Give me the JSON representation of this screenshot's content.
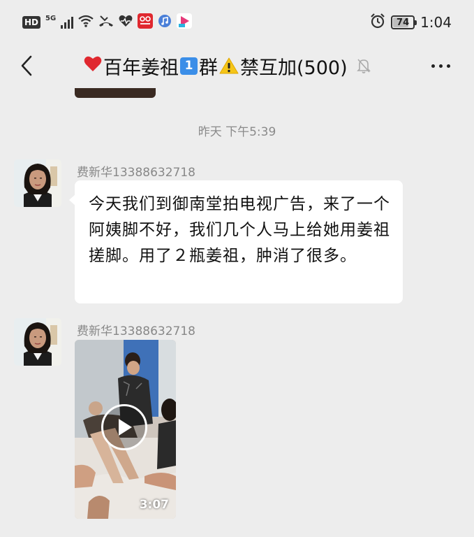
{
  "status_bar": {
    "hd_label": "HD",
    "network_label": "5G",
    "battery_level": "74",
    "battery_fraction": 0.74,
    "time": "1:04",
    "icons": [
      "signal-icon",
      "wifi-icon",
      "missed-call-icon",
      "health-icon",
      "app-notification-icon",
      "music-icon",
      "video-app-icon",
      "alarm-icon"
    ]
  },
  "header": {
    "title_prefix": "百年姜祖",
    "title_badge": "1",
    "title_group": "群",
    "title_suffix": "禁互加(500)",
    "icons": [
      "back-icon",
      "heart-icon",
      "warning-icon",
      "mute-bell-icon",
      "more-icon"
    ]
  },
  "chat": {
    "timestamp": "昨天 下午5:39",
    "messages": [
      {
        "sender": "费新华13388632718",
        "type": "text",
        "text": "今天我们到御南堂拍电视广告，来了一个阿姨脚不好，我们几个人马上给她用姜祖搓脚。用了２瓶姜祖，肿消了很多。"
      },
      {
        "sender": "费新华13388632718",
        "type": "video",
        "duration": "3:07"
      }
    ]
  },
  "colors": {
    "background": "#ededed",
    "bubble": "#ffffff",
    "meta_text": "#888888",
    "heart": "#e0282f",
    "badge": "#3b8ee8",
    "warning": "#f5c518"
  }
}
